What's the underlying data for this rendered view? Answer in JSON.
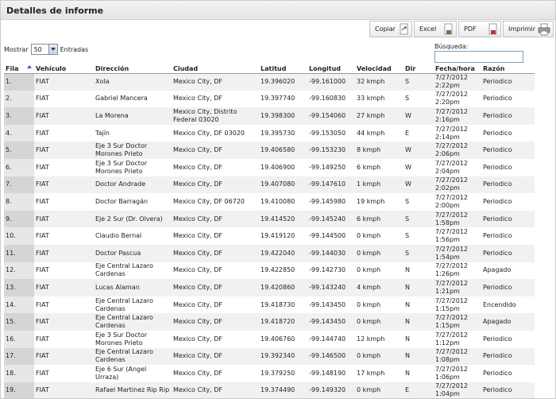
{
  "window": {
    "title": "Detalles de informe"
  },
  "toolbar": {
    "copy_label": "Copiar",
    "excel_label": "Excel",
    "pdf_label": "PDF",
    "print_label": "Imprimir",
    "icons": [
      "copy-icon",
      "excel-icon",
      "pdf-icon",
      "printer-icon"
    ]
  },
  "length": {
    "prefix": "Mostrar",
    "value": "50",
    "suffix": "Entradas"
  },
  "search": {
    "label": "Búsqueda:",
    "value": ""
  },
  "columns": [
    "Fila",
    "Vehículo",
    "Dirección",
    "Ciudad",
    "Latitud",
    "Longitud",
    "Velocidad",
    "Dir",
    "Fecha/hora",
    "Razón"
  ],
  "rows": [
    [
      "1.",
      "FIAT",
      "Xola",
      "Mexico City, DF",
      "19.396020",
      "-99.161000",
      "32 kmph",
      "S",
      "7/27/2012 2:22pm",
      "Periodico"
    ],
    [
      "2.",
      "FIAT",
      "Gabriel Mancera",
      "Mexico City, DF",
      "19.397740",
      "-99.160830",
      "33 kmph",
      "S",
      "7/27/2012 2:20pm",
      "Periodico"
    ],
    [
      "3.",
      "FIAT",
      "La Morena",
      "Mexico City, Distrito Federal 03020",
      "19.398300",
      "-99.154060",
      "27 kmph",
      "W",
      "7/27/2012 2:16pm",
      "Periodico"
    ],
    [
      "4.",
      "FIAT",
      "Tajín",
      "Mexico City, DF 03020",
      "19.395730",
      "-99.153050",
      "44 kmph",
      "E",
      "7/27/2012 2:14pm",
      "Periodico"
    ],
    [
      "5.",
      "FIAT",
      "Eje 3 Sur Doctor Morones Prieto",
      "Mexico City, DF",
      "19.406580",
      "-99.153230",
      "8 kmph",
      "W",
      "7/27/2012 2:06pm",
      "Periodico"
    ],
    [
      "6.",
      "FIAT",
      "Eje 3 Sur Doctor Morones Prieto",
      "Mexico City, DF",
      "19.406900",
      "-99.149250",
      "6 kmph",
      "W",
      "7/27/2012 2:04pm",
      "Periodico"
    ],
    [
      "7.",
      "FIAT",
      "Doctor Andrade",
      "Mexico City, DF",
      "19.407080",
      "-99.147610",
      "1 kmph",
      "W",
      "7/27/2012 2:02pm",
      "Periodico"
    ],
    [
      "8.",
      "FIAT",
      "Doctor Barragán",
      "Mexico City, DF 06720",
      "19.410080",
      "-99.145980",
      "19 kmph",
      "S",
      "7/27/2012 2:00pm",
      "Periodico"
    ],
    [
      "9.",
      "FIAT",
      "Eje 2 Sur (Dr. Olvera)",
      "Mexico City, DF",
      "19.414520",
      "-99.145240",
      "6 kmph",
      "S",
      "7/27/2012 1:58pm",
      "Periodico"
    ],
    [
      "10.",
      "FIAT",
      "Claudio Bernal",
      "Mexico City, DF",
      "19.419120",
      "-99.144500",
      "0 kmph",
      "S",
      "7/27/2012 1:56pm",
      "Periodico"
    ],
    [
      "11.",
      "FIAT",
      "Doctor Pascua",
      "Mexico City, DF",
      "19.422040",
      "-99.144030",
      "0 kmph",
      "S",
      "7/27/2012 1:54pm",
      "Periodico"
    ],
    [
      "12.",
      "FIAT",
      "Eje Central Lazaro Cardenas",
      "Mexico City, DF",
      "19.422850",
      "-99.142730",
      "0 kmph",
      "N",
      "7/27/2012 1:26pm",
      "Apagado"
    ],
    [
      "13.",
      "FIAT",
      "Lucas Alaman",
      "Mexico City, DF",
      "19.420860",
      "-99.143240",
      "4 kmph",
      "N",
      "7/27/2012 1:21pm",
      "Periodico"
    ],
    [
      "14.",
      "FIAT",
      "Eje Central Lazaro Cardenas",
      "Mexico City, DF",
      "19.418730",
      "-99.143450",
      "0 kmph",
      "N",
      "7/27/2012 1:15pm",
      "Encendido"
    ],
    [
      "15.",
      "FIAT",
      "Eje Central Lazaro Cardenas",
      "Mexico City, DF",
      "19.418720",
      "-99.143450",
      "0 kmph",
      "N",
      "7/27/2012 1:15pm",
      "Apagado"
    ],
    [
      "16.",
      "FIAT",
      "Eje 3 Sur Doctor Morones Prieto",
      "Mexico City, DF",
      "19.406760",
      "-99.144740",
      "12 kmph",
      "N",
      "7/27/2012 1:12pm",
      "Periodico"
    ],
    [
      "17.",
      "FIAT",
      "Eje Central Lazaro Cardenas",
      "Mexico City, DF",
      "19.392340",
      "-99.146500",
      "0 kmph",
      "N",
      "7/27/2012 1:08pm",
      "Periodico"
    ],
    [
      "18.",
      "FIAT",
      "Eje 6 Sur (Angel Urraza)",
      "Mexico City, DF",
      "19.379250",
      "-99.148190",
      "17 kmph",
      "N",
      "7/27/2012 1:06pm",
      "Periodico"
    ],
    [
      "19.",
      "FIAT",
      "Rafael Martinez Rip Rip",
      "Mexico City, DF",
      "19.374490",
      "-99.149320",
      "0 kmph",
      "E",
      "7/27/2012 1:04pm",
      "Periodico"
    ]
  ]
}
